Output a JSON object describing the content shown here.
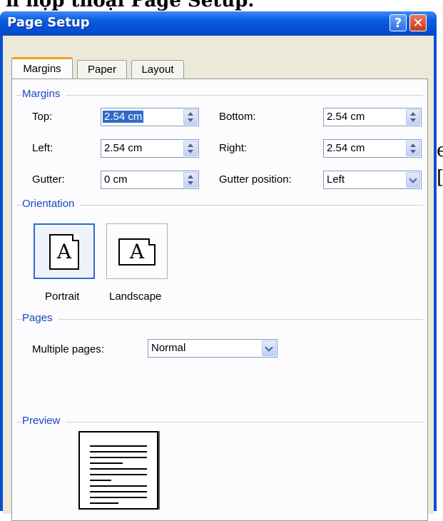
{
  "background": {
    "heading": "n hộp thoại Page Setup.",
    "right_chars": [
      "e",
      "["
    ]
  },
  "window": {
    "title": "Page Setup",
    "help_glyph": "?",
    "close_glyph": "✕"
  },
  "tabs": [
    {
      "label": "Margins",
      "active": true
    },
    {
      "label": "Paper",
      "active": false
    },
    {
      "label": "Layout",
      "active": false
    }
  ],
  "margins": {
    "group_label": "Margins",
    "top": {
      "label": "Top:",
      "value": "2.54 cm"
    },
    "bottom": {
      "label": "Bottom:",
      "value": "2.54 cm"
    },
    "left": {
      "label": "Left:",
      "value": "2.54 cm"
    },
    "right": {
      "label": "Right:",
      "value": "2.54 cm"
    },
    "gutter": {
      "label": "Gutter:",
      "value": "0 cm"
    },
    "gutter_position": {
      "label": "Gutter position:",
      "value": "Left"
    }
  },
  "orientation": {
    "group_label": "Orientation",
    "portrait": {
      "label": "Portrait",
      "glyph": "A",
      "selected": true
    },
    "landscape": {
      "label": "Landscape",
      "glyph": "A",
      "selected": false
    }
  },
  "pages": {
    "group_label": "Pages",
    "multiple_pages": {
      "label": "Multiple pages:",
      "value": "Normal"
    }
  },
  "preview": {
    "group_label": "Preview"
  },
  "colors": {
    "titlebar": "#0b5fe0",
    "group_label": "#1a45c0",
    "active_tab_accent": "#f0a020",
    "selection": "#316ac5"
  }
}
